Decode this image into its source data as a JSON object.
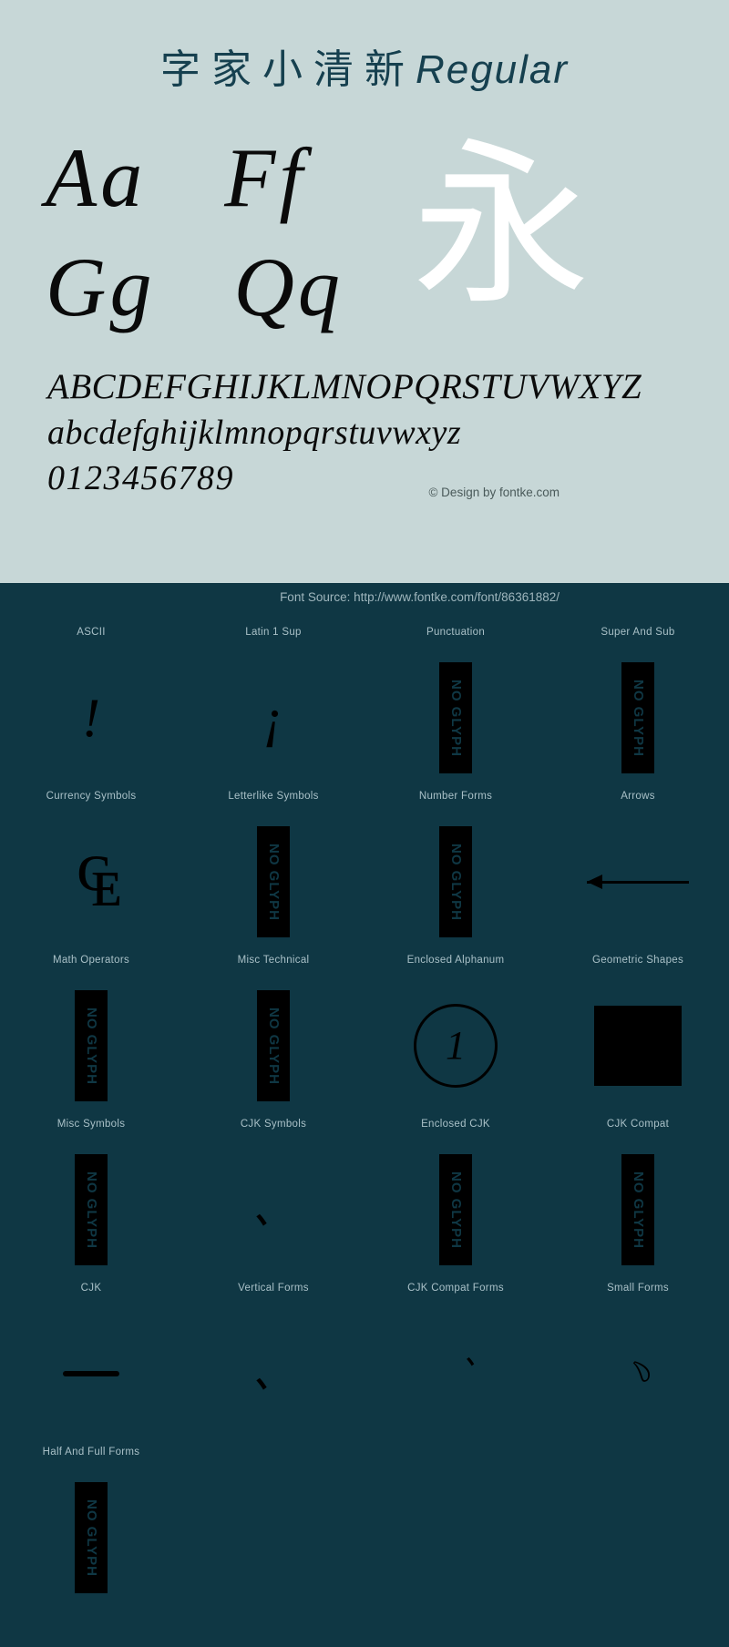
{
  "specimen": {
    "title_cjk": "字家小清新",
    "title_latin": "Regular",
    "pairs": [
      [
        "Aa",
        "Ff"
      ],
      [
        "Gg",
        "Qq"
      ]
    ],
    "cjk_showcase": "永",
    "uppercase": "ABCDEFGHIJKLMNOPQRSTUVWXYZ",
    "lowercase": "abcdefghijklmnopqrstuvwxyz",
    "digits": "0123456789",
    "credit": "© Design by fontke.com",
    "bg_color": "#c7d7d7",
    "ink_color": "#0b0b0b",
    "title_color": "#16404f"
  },
  "dark_panel": {
    "source_line": "Font Source: http://www.fontke.com/font/86361882/",
    "bg_color": "#0f3744",
    "label_color": "#a9c0c7",
    "no_glyph_text": "NO GLYPH",
    "blocks": [
      {
        "label": "ASCII",
        "glyph": "!",
        "kind": "glyph",
        "size": "stroke-a"
      },
      {
        "label": "Latin 1 Sup",
        "glyph": "¡",
        "kind": "glyph",
        "size": "stroke-a"
      },
      {
        "label": "Punctuation",
        "glyph": "",
        "kind": "noglyph",
        "size": ""
      },
      {
        "label": "Super And Sub",
        "glyph": "",
        "kind": "noglyph",
        "size": ""
      },
      {
        "label": "Currency Symbols",
        "glyph": "₠",
        "kind": "currency",
        "size": ""
      },
      {
        "label": "Letterlike Symbols",
        "glyph": "",
        "kind": "noglyph",
        "size": ""
      },
      {
        "label": "Number Forms",
        "glyph": "",
        "kind": "noglyph",
        "size": ""
      },
      {
        "label": "Arrows",
        "glyph": "←",
        "kind": "arrow",
        "size": ""
      },
      {
        "label": "Math Operators",
        "glyph": "",
        "kind": "noglyph",
        "size": ""
      },
      {
        "label": "Misc Technical",
        "glyph": "",
        "kind": "noglyph",
        "size": ""
      },
      {
        "label": "Enclosed Alphanum",
        "glyph": "1",
        "kind": "circled",
        "size": ""
      },
      {
        "label": "Geometric Shapes",
        "glyph": "■",
        "kind": "square",
        "size": ""
      },
      {
        "label": "Misc Symbols",
        "glyph": "",
        "kind": "noglyph",
        "size": ""
      },
      {
        "label": "CJK Symbols",
        "glyph": "、",
        "kind": "glyph",
        "size": "stroke-b"
      },
      {
        "label": "Enclosed CJK",
        "glyph": "",
        "kind": "noglyph",
        "size": ""
      },
      {
        "label": "CJK Compat",
        "glyph": "",
        "kind": "noglyph",
        "size": ""
      },
      {
        "label": "CJK",
        "glyph": "一",
        "kind": "dash",
        "size": ""
      },
      {
        "label": "Vertical Forms",
        "glyph": "、",
        "kind": "glyph",
        "size": "stroke-b"
      },
      {
        "label": "CJK Compat Forms",
        "glyph": "︑",
        "kind": "glyph",
        "size": "stroke-c"
      },
      {
        "label": "Small Forms",
        "glyph": "﹆",
        "kind": "glyph",
        "size": "stroke-c"
      },
      {
        "label": "Half And Full Forms",
        "glyph": "",
        "kind": "noglyph",
        "size": ""
      }
    ]
  }
}
